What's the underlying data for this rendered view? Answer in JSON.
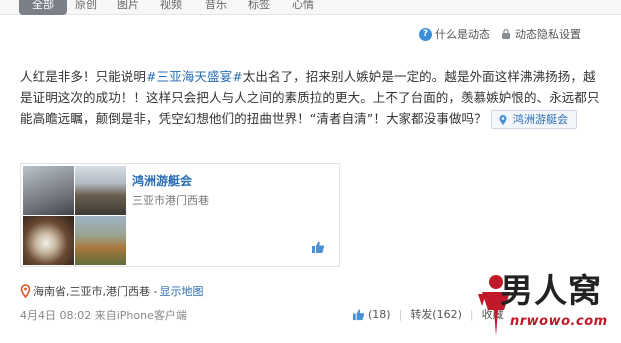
{
  "tabs": [
    "全部",
    "原创",
    "图片",
    "视频",
    "音乐",
    "标签",
    "心情"
  ],
  "help": {
    "what_is_feed": "什么是动态",
    "privacy_settings": "动态隐私设置"
  },
  "post": {
    "text_before": "人红是非多！只能说明",
    "hashtag": "#三亚海天盛宴#",
    "text_after": "太出名了，招来别人嫉妒是一定的。越是外面这样沸沸扬扬，越是证明这次的成功！！这样只会把人与人之间的素质拉的更大。上不了台面的，羡慕嫉妒恨的、永远都只能高瞻远瞩，颠倒是非，凭空幻想他们的扭曲世界！“清者自清”！大家都没事做吗？",
    "venue_chip": "鸿洲游艇会"
  },
  "card": {
    "title": "鸿洲游艇会",
    "address": "三亚市港门西巷"
  },
  "location": {
    "text": "海南省,三亚市,港门西巷 - ",
    "map_link": "显示地图"
  },
  "meta": {
    "time_source": "4月4日 08:02  来自iPhone客户端"
  },
  "actions": {
    "like": "(18)",
    "repost": "转发(162)",
    "favorite": "收藏"
  },
  "brand": {
    "name": "男人窝",
    "url": "nrwowo.com"
  },
  "colors": {
    "link": "#2a6db3",
    "active_tab": "#7b8088",
    "brand_red": "#c01a2a"
  }
}
